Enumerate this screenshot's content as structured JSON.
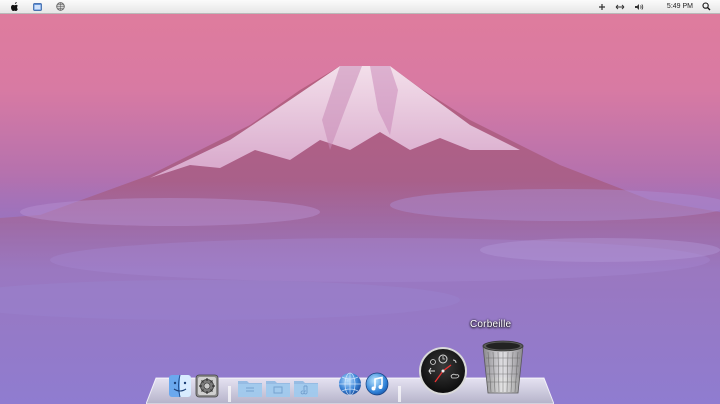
{
  "menubar": {
    "left_icons": [
      "apple-icon",
      "finder-window-icon",
      "network-globe-icon"
    ],
    "right_icons": [
      "add-icon",
      "sync-arrows-icon",
      "volume-icon"
    ],
    "clock": "5:49 PM",
    "search_icon": "spotlight-search-icon"
  },
  "desktop": {
    "wallpaper": "Mount Fuji at dusk, pink and purple sky",
    "colors": {
      "sky_top": "#e07a9b",
      "sky_mid": "#c86fa6",
      "haze": "#8a6fc0",
      "snow": "#f3e2ee"
    }
  },
  "dock": {
    "items": [
      {
        "name": "finder",
        "icon": "finder-icon"
      },
      {
        "name": "system-preferences",
        "icon": "system-preferences-icon"
      },
      {
        "name": "applications-stack",
        "icon": "folder-icon"
      },
      {
        "name": "documents-stack",
        "icon": "folder-icon"
      },
      {
        "name": "downloads-stack",
        "icon": "folder-icon"
      },
      {
        "name": "safari",
        "icon": "safari-globe-icon"
      },
      {
        "name": "itunes",
        "icon": "itunes-icon"
      },
      {
        "name": "dashboard",
        "icon": "dashboard-icon"
      },
      {
        "name": "trash",
        "icon": "trash-icon",
        "label": "Corbeille"
      }
    ]
  }
}
